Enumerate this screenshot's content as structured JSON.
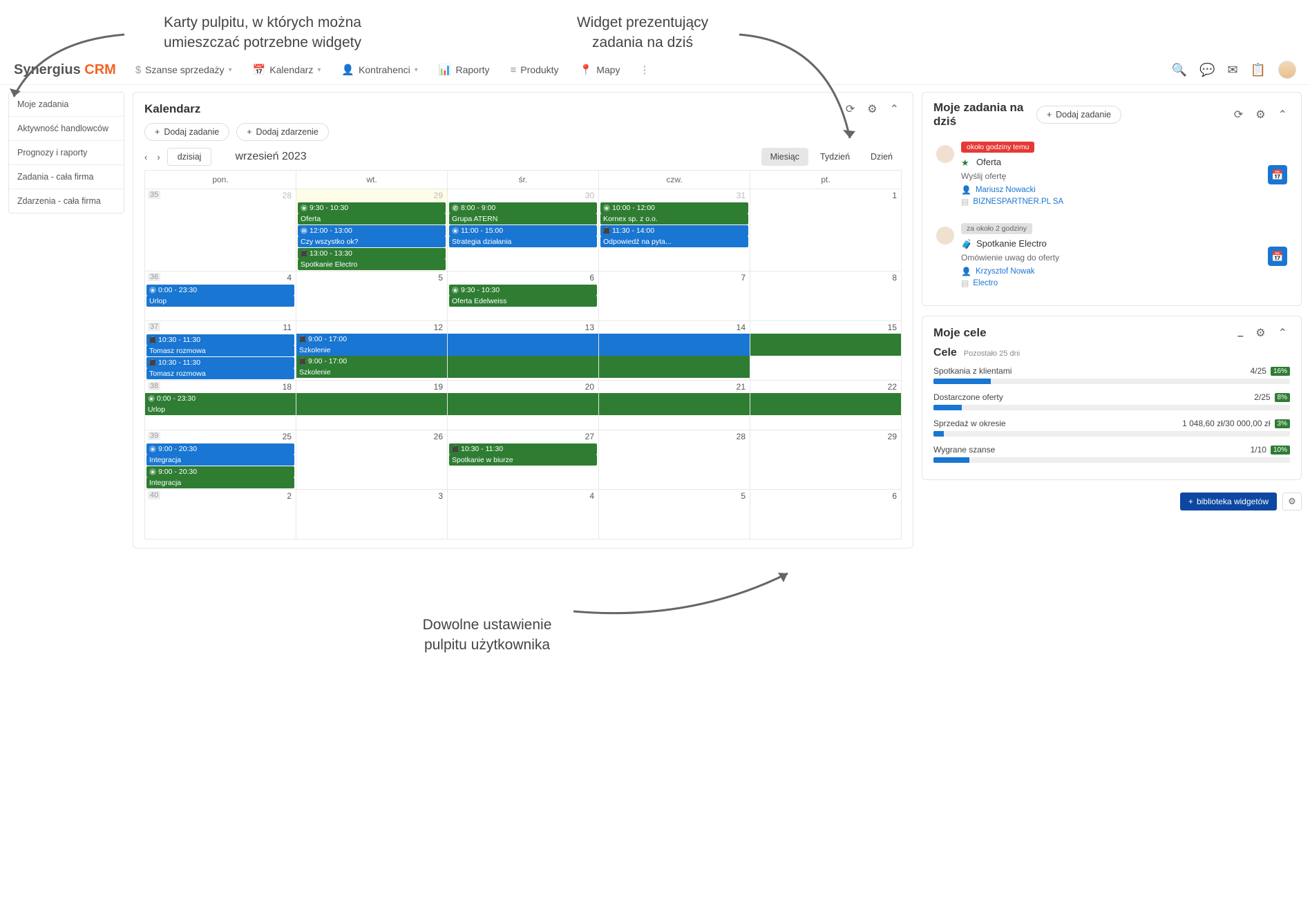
{
  "annotations": {
    "top_left": "Karty pulpitu, w których można\numieszczać potrzebne widgety",
    "top_right": "Widget prezentujący\nzadania na dziś",
    "bottom": "Dowolne ustawienie\npulpitu użytkownika"
  },
  "logo": {
    "main": "Synergius",
    "accent": "CRM"
  },
  "nav": {
    "items": [
      {
        "label": "Szanse sprzedaży",
        "icon": "$",
        "dropdown": true
      },
      {
        "label": "Kalendarz",
        "icon": "📅",
        "dropdown": true
      },
      {
        "label": "Kontrahenci",
        "icon": "👤",
        "dropdown": true
      },
      {
        "label": "Raporty",
        "icon": "📊",
        "dropdown": false
      },
      {
        "label": "Produkty",
        "icon": "≡",
        "dropdown": false
      },
      {
        "label": "Mapy",
        "icon": "📍",
        "dropdown": false
      }
    ]
  },
  "sidebar": {
    "items": [
      {
        "label": "Moje zadania"
      },
      {
        "label": "Aktywność handlowców"
      },
      {
        "label": "Prognozy i raporty"
      },
      {
        "label": "Zadania - cała firma"
      },
      {
        "label": "Zdarzenia - cała firma"
      }
    ]
  },
  "calendar": {
    "title": "Kalendarz",
    "add_task": "Dodaj zadanie",
    "add_event": "Dodaj zdarzenie",
    "today_btn": "dzisiaj",
    "period_label": "wrzesień 2023",
    "views": {
      "month": "Miesiąc",
      "week": "Tydzień",
      "day": "Dzień"
    },
    "day_heads": [
      "pon.",
      "wt.",
      "śr.",
      "czw.",
      "pt."
    ],
    "weeks": [
      {
        "wk": "35",
        "days": [
          {
            "num": "28",
            "muted": true,
            "events": []
          },
          {
            "num": "29",
            "muted": true,
            "today": true,
            "events": [
              {
                "color": "green",
                "time": "9:30 - 10:30",
                "text": "Oferta",
                "ico": "★"
              },
              {
                "color": "blue",
                "time": "12:00 - 13:00",
                "text": "Czy wszystko ok?",
                "ico": "✉"
              },
              {
                "color": "green",
                "time": "13:00 - 13:30",
                "text": "Spotkanie Electro",
                "ico": "⬛"
              }
            ]
          },
          {
            "num": "30",
            "muted": true,
            "events": [
              {
                "color": "green",
                "time": "8:00 - 9:00",
                "text": "Grupa ATERN",
                "ico": "✆"
              },
              {
                "color": "blue",
                "time": "11:00 - 15:00",
                "text": "Strategia działania",
                "ico": "★"
              }
            ]
          },
          {
            "num": "31",
            "muted": true,
            "events": [
              {
                "color": "green",
                "time": "10:00 - 12:00",
                "text": "Kornex sp. z o.o.",
                "ico": "★"
              },
              {
                "color": "blue",
                "time": "11:30 - 14:00",
                "text": "Odpowiedź na pyta...",
                "ico": "⬛"
              }
            ]
          },
          {
            "num": "1",
            "events": []
          }
        ]
      },
      {
        "wk": "36",
        "days": [
          {
            "num": "4",
            "events": [
              {
                "color": "blue",
                "time": "0:00 - 23:30",
                "text": "Urlop",
                "ico": "★"
              }
            ]
          },
          {
            "num": "5",
            "events": []
          },
          {
            "num": "6",
            "events": [
              {
                "color": "green",
                "time": "9:30 - 10:30",
                "text": "Oferta Edelweiss",
                "ico": "★"
              }
            ]
          },
          {
            "num": "7",
            "events": []
          },
          {
            "num": "8",
            "events": []
          }
        ]
      },
      {
        "wk": "37",
        "tall": true,
        "days": [
          {
            "num": "11",
            "events": [
              {
                "color": "blue",
                "time": "10:30 - 11:30",
                "text": "Tomasz rozmowa",
                "ico": "⬛"
              },
              {
                "color": "blue",
                "time": "10:30 - 11:30",
                "text": "Tomasz rozmowa",
                "ico": "⬛"
              }
            ]
          },
          {
            "num": "12",
            "events": []
          },
          {
            "num": "13",
            "events": []
          },
          {
            "num": "14",
            "events": []
          },
          {
            "num": "15",
            "events": []
          }
        ],
        "spans": [
          {
            "color": "blue",
            "from": 2,
            "to": 4,
            "time": "9:00 - 17:00",
            "text": "Szkolenie",
            "ico": "⬛"
          },
          {
            "color": "green",
            "from": 2,
            "to": 5,
            "time": "9:00 - 17:00",
            "text": "Szkolenie",
            "ico": "⬛"
          }
        ]
      },
      {
        "wk": "38",
        "days": [
          {
            "num": "18",
            "events": []
          },
          {
            "num": "19",
            "events": []
          },
          {
            "num": "20",
            "events": []
          },
          {
            "num": "21",
            "events": []
          },
          {
            "num": "22",
            "events": []
          }
        ],
        "spans": [
          {
            "color": "green",
            "from": 1,
            "to": 5,
            "time": "0:00 - 23:30",
            "text": "Urlop",
            "ico": "★"
          }
        ]
      },
      {
        "wk": "39",
        "days": [
          {
            "num": "25",
            "events": [
              {
                "color": "blue",
                "time": "9:00 - 20:30",
                "text": "Integracja",
                "ico": "★"
              },
              {
                "color": "green",
                "time": "9:00 - 20:30",
                "text": "Integracja",
                "ico": "★"
              }
            ]
          },
          {
            "num": "26",
            "events": []
          },
          {
            "num": "27",
            "events": [
              {
                "color": "green",
                "time": "10:30 - 11:30",
                "text": "Spotkanie w biurze",
                "ico": "⬛"
              }
            ]
          },
          {
            "num": "28",
            "events": []
          },
          {
            "num": "29",
            "events": []
          }
        ]
      },
      {
        "wk": "40",
        "days": [
          {
            "num": "2",
            "events": []
          },
          {
            "num": "3",
            "events": []
          },
          {
            "num": "4",
            "events": []
          },
          {
            "num": "5",
            "events": []
          },
          {
            "num": "6",
            "events": []
          }
        ]
      }
    ]
  },
  "tasks": {
    "title": "Moje zadania na dziś",
    "add_btn": "Dodaj zadanie",
    "items": [
      {
        "badge_class": "red",
        "badge": "około godziny temu",
        "icon": "★",
        "icon_class": "ico-star",
        "title": "Oferta",
        "desc": "Wyślij ofertę",
        "person": "Mariusz Nowacki",
        "company": "BIZNESPARTNER.PL SA"
      },
      {
        "badge_class": "gray",
        "badge": "za około 2 godziny",
        "icon": "🧳",
        "icon_class": "ico-bag",
        "title": "Spotkanie Electro",
        "desc": "Omówienie uwag do oferty",
        "person": "Krzysztof Nowak",
        "company": "Electro"
      }
    ]
  },
  "goals": {
    "panel_title": "Moje cele",
    "head_title": "Cele",
    "head_sub": "Pozostało 25 dni",
    "items": [
      {
        "label": "Spotkania z klientami",
        "value": "4/25",
        "pct": "16%",
        "fill": 16
      },
      {
        "label": "Dostarczone oferty",
        "value": "2/25",
        "pct": "8%",
        "fill": 8
      },
      {
        "label": "Sprzedaż w okresie",
        "value": "1 048,60 zł/30 000,00 zł",
        "pct": "3%",
        "fill": 3
      },
      {
        "label": "Wygrane szanse",
        "value": "1/10",
        "pct": "10%",
        "fill": 10
      }
    ]
  },
  "footer": {
    "library_btn": "biblioteka widgetów"
  }
}
